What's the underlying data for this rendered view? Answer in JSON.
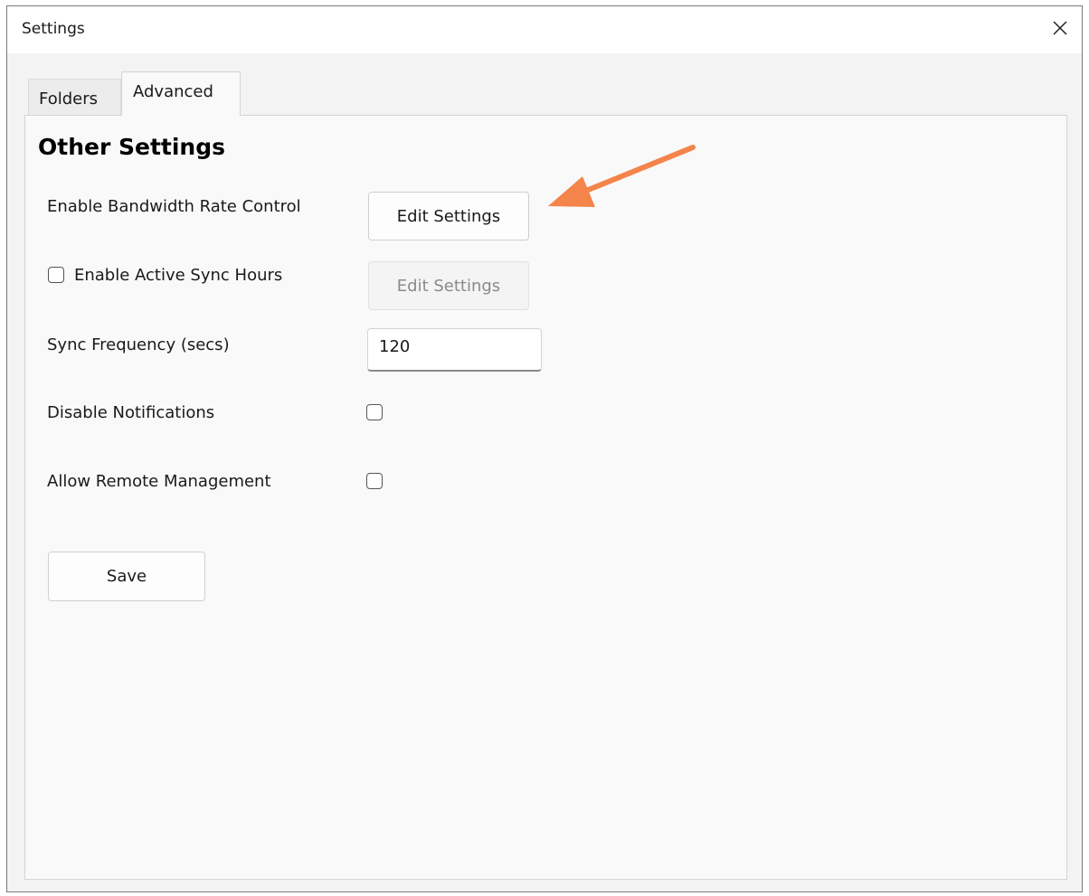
{
  "window": {
    "title": "Settings"
  },
  "tabs": [
    {
      "label": "Folders",
      "active": false
    },
    {
      "label": "Advanced",
      "active": true
    }
  ],
  "section": {
    "title": "Other Settings"
  },
  "settings": {
    "bandwidth": {
      "label": "Enable Bandwidth Rate Control",
      "button_label": "Edit Settings"
    },
    "active_sync": {
      "label": "Enable Active Sync Hours",
      "checked": false,
      "button_label": "Edit Settings",
      "button_disabled": true
    },
    "sync_frequency": {
      "label": "Sync Frequency (secs)",
      "value": "120"
    },
    "notifications": {
      "label": "Disable Notifications",
      "checked": false
    },
    "remote_management": {
      "label": "Allow Remote Management",
      "checked": false
    }
  },
  "actions": {
    "save_label": "Save"
  },
  "annotation": {
    "arrow_color": "#f4844a"
  }
}
